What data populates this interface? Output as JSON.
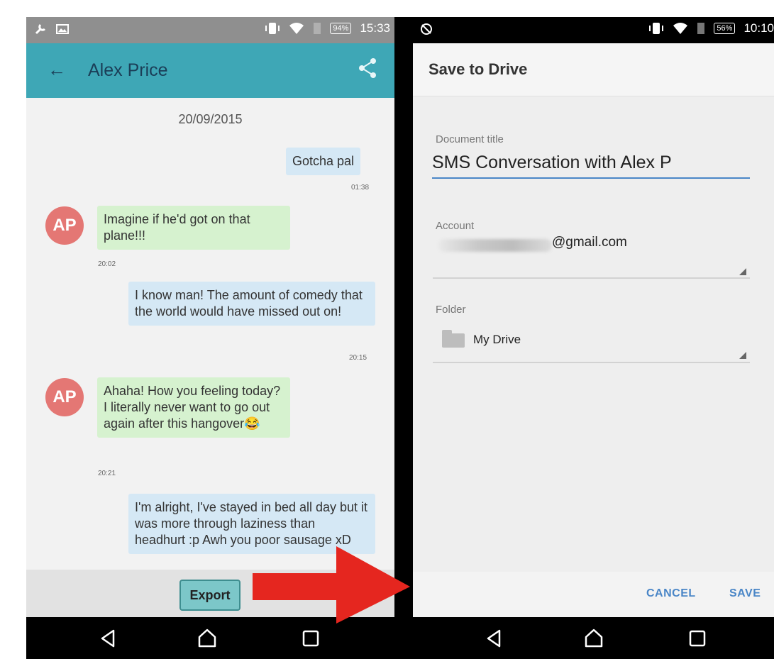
{
  "left": {
    "status": {
      "battery": "94%",
      "time": "15:33"
    },
    "appbar": {
      "title": "Alex Price"
    },
    "chat": {
      "date": "20/09/2015",
      "avatar_initials": "AP",
      "messages": [
        {
          "dir": "out",
          "text": "Gotcha pal",
          "time": "01:38"
        },
        {
          "dir": "in",
          "text": "Imagine if he'd got on that plane!!!",
          "time": "20:02"
        },
        {
          "dir": "out",
          "text": "I know man! The amount of comedy that the world would have missed out on!",
          "time": "20:15"
        },
        {
          "dir": "in",
          "text": "Ahaha! How you feeling today? I literally never want to go out again after this hangover😂",
          "time": "20:21"
        },
        {
          "dir": "out",
          "text": "I'm alright, I've stayed in bed all day but it was more through laziness than headhurt :p Awh you poor sausage xD",
          "time": ""
        }
      ]
    },
    "bottom": {
      "export_label": "Export"
    }
  },
  "right": {
    "status": {
      "battery": "56%",
      "time": "10:10"
    },
    "header": {
      "title": "Save to Drive"
    },
    "form": {
      "doc_title_label": "Document title",
      "doc_title_value": "SMS Conversation with Alex P",
      "account_label": "Account",
      "account_value": "@gmail.com",
      "folder_label": "Folder",
      "folder_value": "My Drive"
    },
    "actions": {
      "cancel": "CANCEL",
      "save": "SAVE"
    }
  },
  "colors": {
    "appbar": "#3ea7b6",
    "incoming_bubble": "#d6f2cf",
    "outgoing_bubble": "#d5e8f5",
    "avatar": "#e47774",
    "arrow": "#e5261f",
    "accent_blue": "#4a86c7"
  },
  "icons": [
    "wrench-icon",
    "image-icon",
    "vibrate-icon",
    "wifi-icon",
    "sim-icon",
    "battery-icon",
    "back-arrow-icon",
    "share-icon",
    "nav-back-icon",
    "nav-home-icon",
    "nav-recents-icon",
    "no-sync-icon",
    "folder-icon",
    "dropdown-triangle-icon",
    "red-arrow-icon"
  ]
}
